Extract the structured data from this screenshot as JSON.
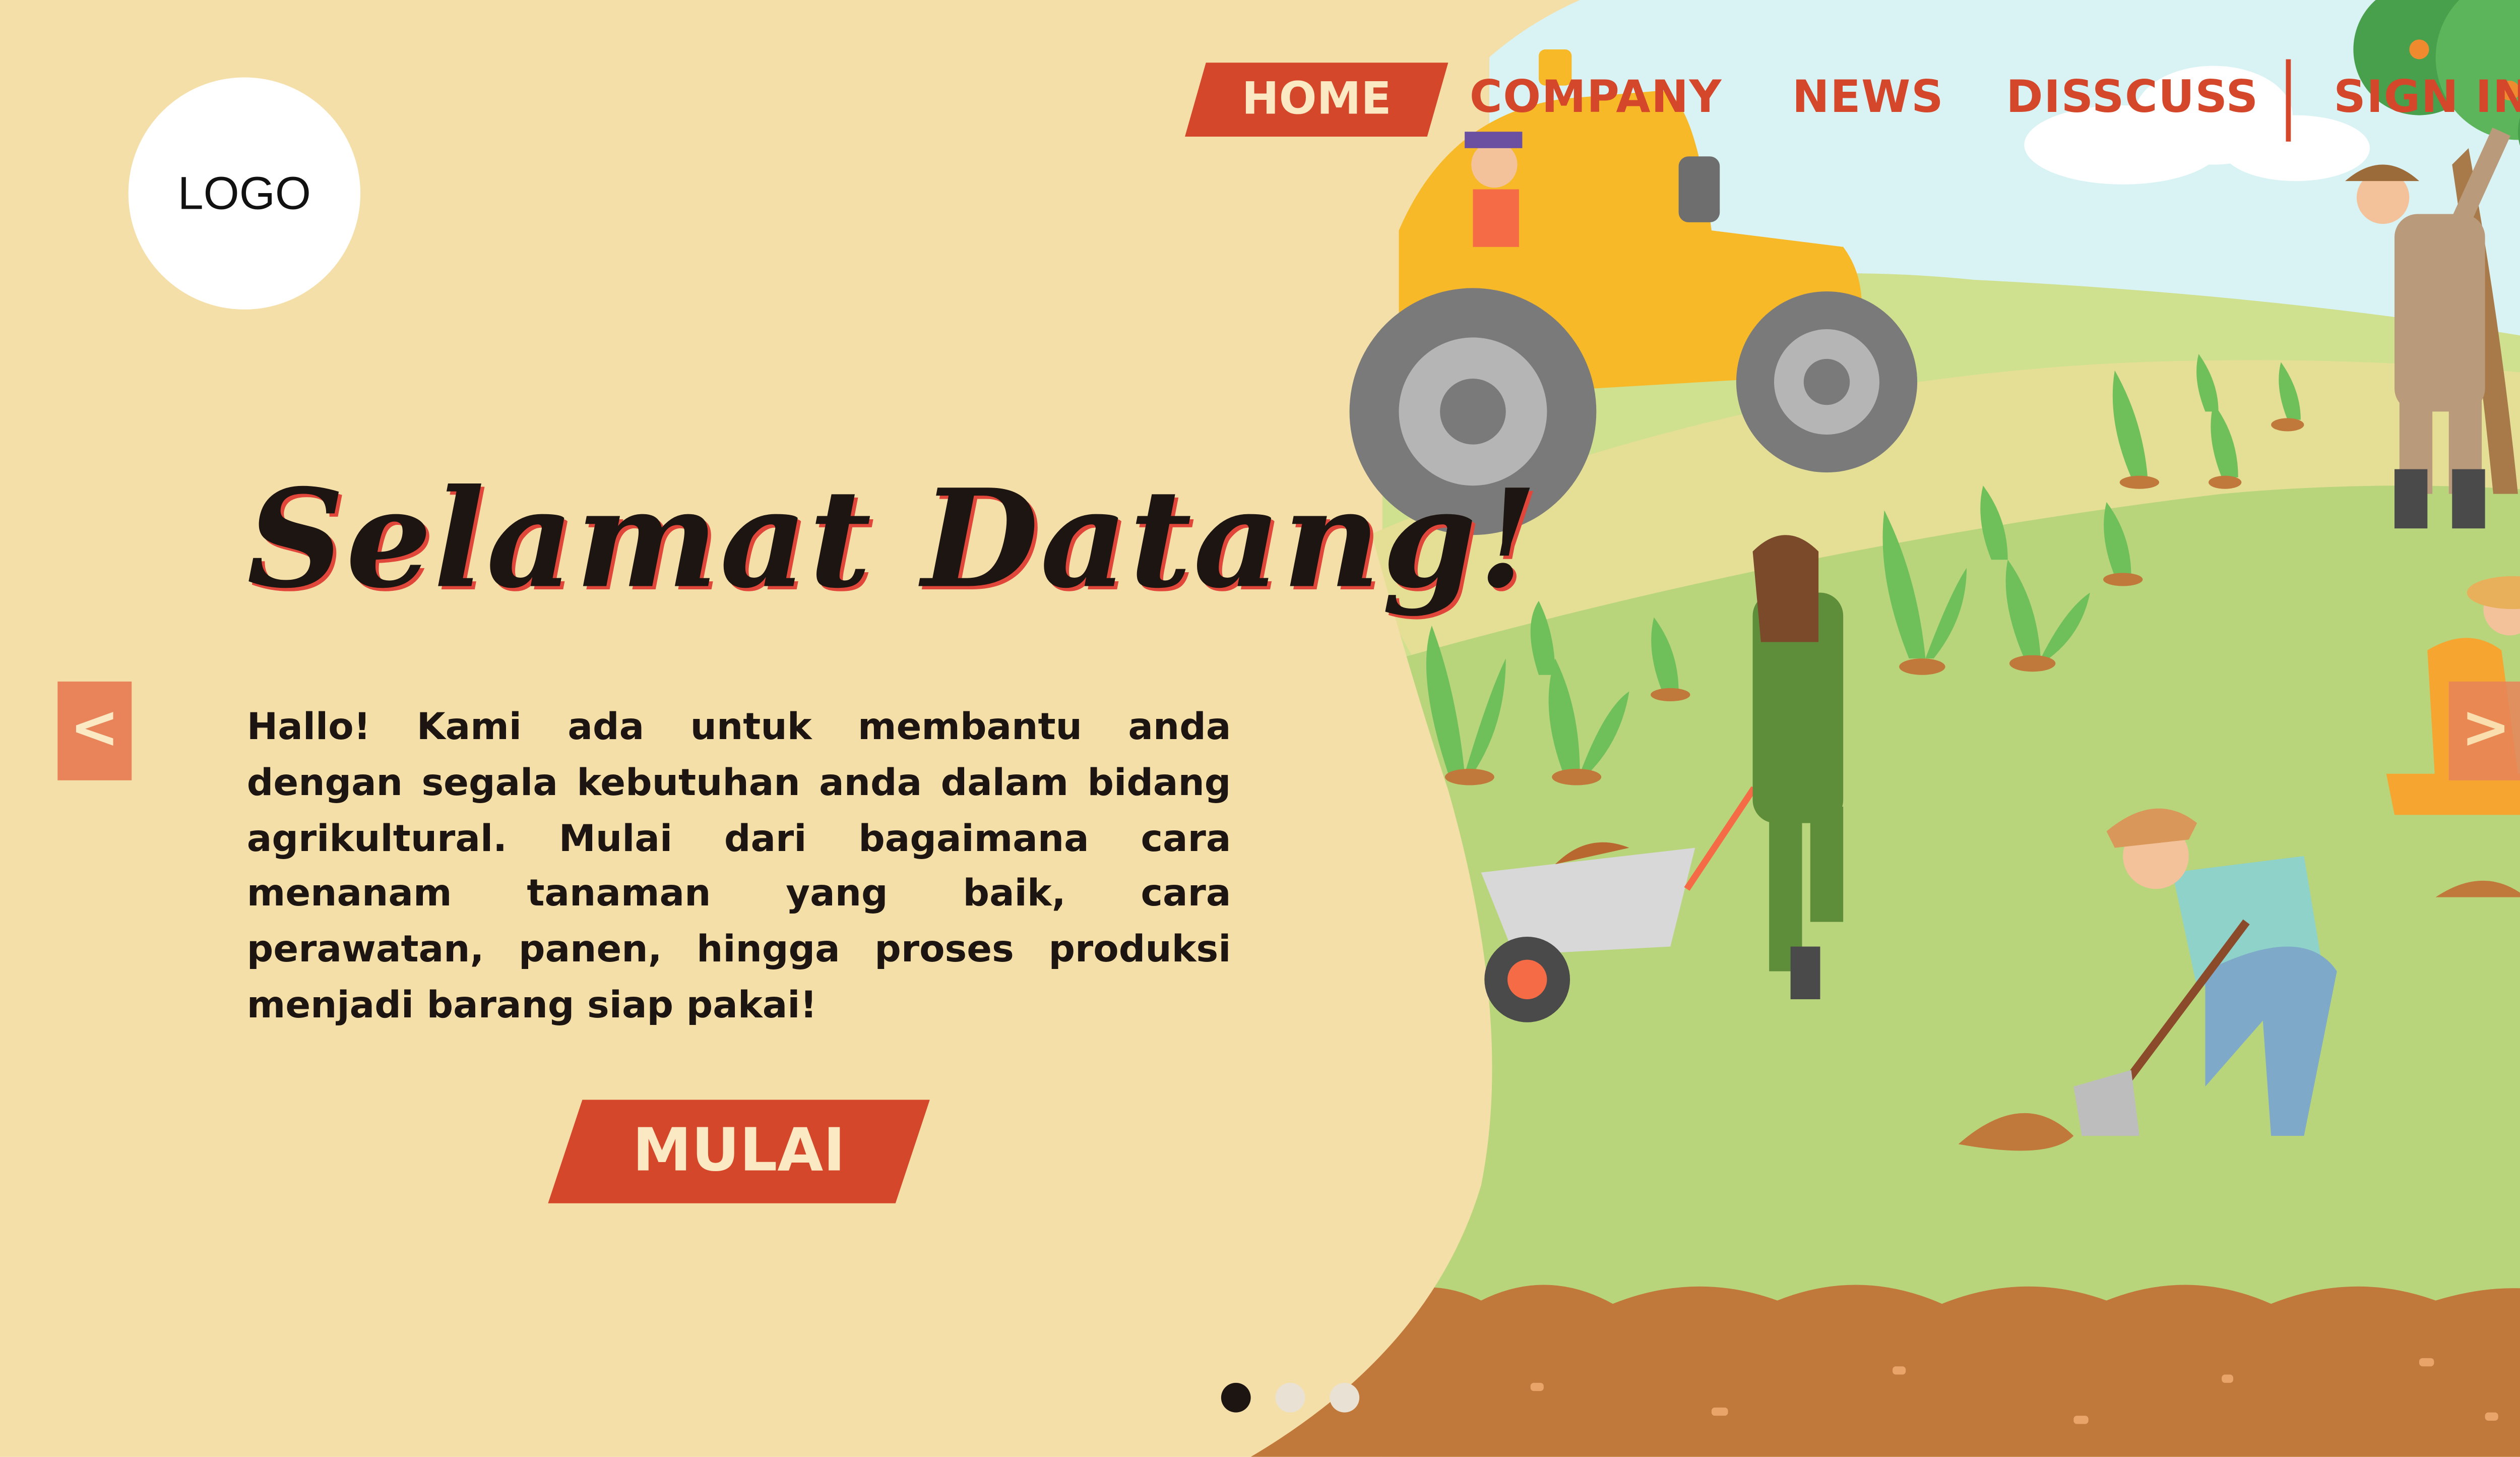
{
  "logo": {
    "text": "LOGO"
  },
  "nav": {
    "items": [
      {
        "label": "HOME",
        "active": true
      },
      {
        "label": "COMPANY",
        "active": false
      },
      {
        "label": "NEWS",
        "active": false
      },
      {
        "label": "DISSCUSS",
        "active": false
      },
      {
        "label": "SIGN IN",
        "active": false
      }
    ]
  },
  "hero": {
    "title": "Selamat Datang!",
    "body": "Hallo! Kami ada untuk membantu anda dengan segala kebutuhan anda dalam bidang agrikultural. Mulai dari bagaimana cara menanam tanaman yang baik, cara perawatan, panen, hingga proses produksi menjadi barang siap pakai!",
    "cta_label": "MULAI"
  },
  "carousel": {
    "prev_icon": "chevron-left-icon",
    "next_icon": "chevron-right-icon",
    "prev_glyph": "<",
    "next_glyph": ">",
    "slide_count": 3,
    "active_index": 0
  },
  "colors": {
    "background": "#f5dfa8",
    "accent": "#d4472a",
    "accent_text": "#fbe9c3",
    "arrow_bg": "#e8835a",
    "grass": "#b8d57c",
    "soil": "#c0793a",
    "sky": "#d9f3f5"
  }
}
